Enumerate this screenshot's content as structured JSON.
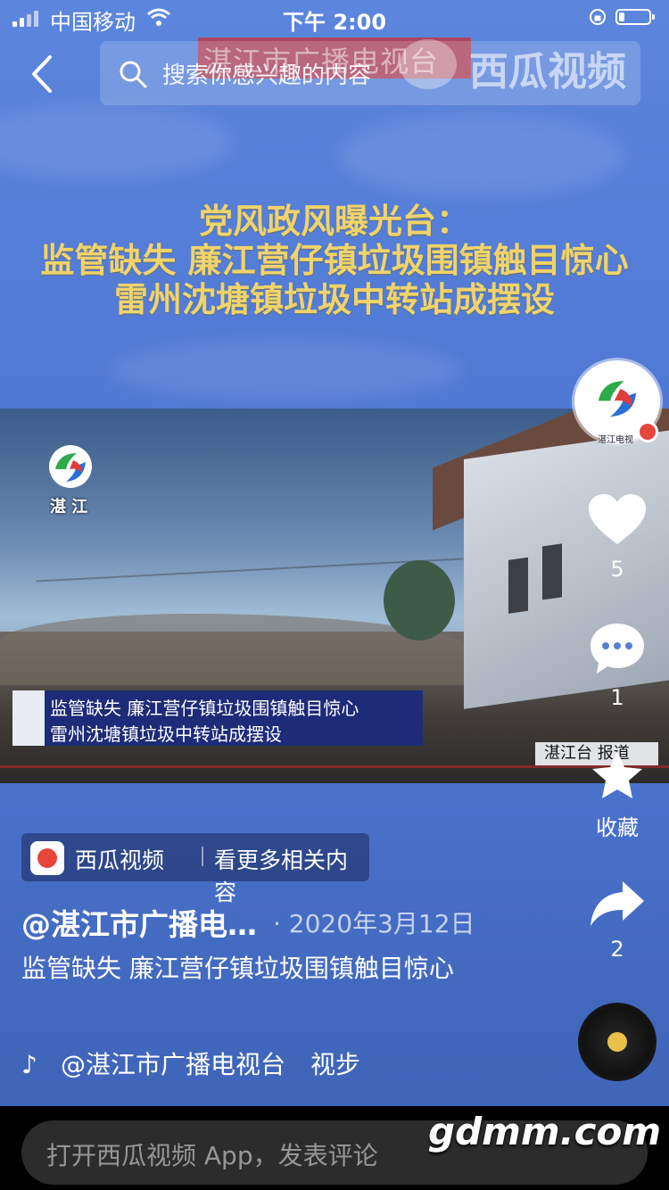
{
  "status_bar": {
    "carrier": "中国移动",
    "time": "下午 2:00"
  },
  "search": {
    "placeholder": "搜索你感兴趣的内容"
  },
  "watermark_top": {
    "red_banner": "湛江市广播电视台",
    "brand": "西瓜视频"
  },
  "headline": {
    "line1": "党风政风曝光台：",
    "line2": "监管缺失 廉江营仔镇垃圾围镇触目惊心",
    "line3": "雷州沈塘镇垃圾中转站成摆设"
  },
  "video": {
    "channel_name": "湛 江",
    "lower_third_line1": "监管缺失  廉江营仔镇垃圾围镇触目惊心",
    "lower_third_line2": "雷州沈塘镇垃圾中转站成摆设",
    "report_tag": "湛江台 报道"
  },
  "rail": {
    "avatar_sub": "湛江电视",
    "likes": "5",
    "comments": "1",
    "favorite_label": "收藏",
    "shares": "2"
  },
  "info": {
    "pill_brand": "西瓜视频",
    "pill_more": "看更多相关内容",
    "author": "@湛江市广播电…",
    "date": "· 2020年3月12日",
    "description": "监管缺失 廉江营仔镇垃圾围镇触目惊心",
    "music_author": "@湛江市广播电视台",
    "music_tail": "视步"
  },
  "bottom": {
    "comment_placeholder": "打开西瓜视频 App，发表评论",
    "site_watermark": "gdmm.com"
  },
  "colors": {
    "background": "#4f79d4",
    "headline": "#f0d36b",
    "brand_red": "#e8453c"
  }
}
